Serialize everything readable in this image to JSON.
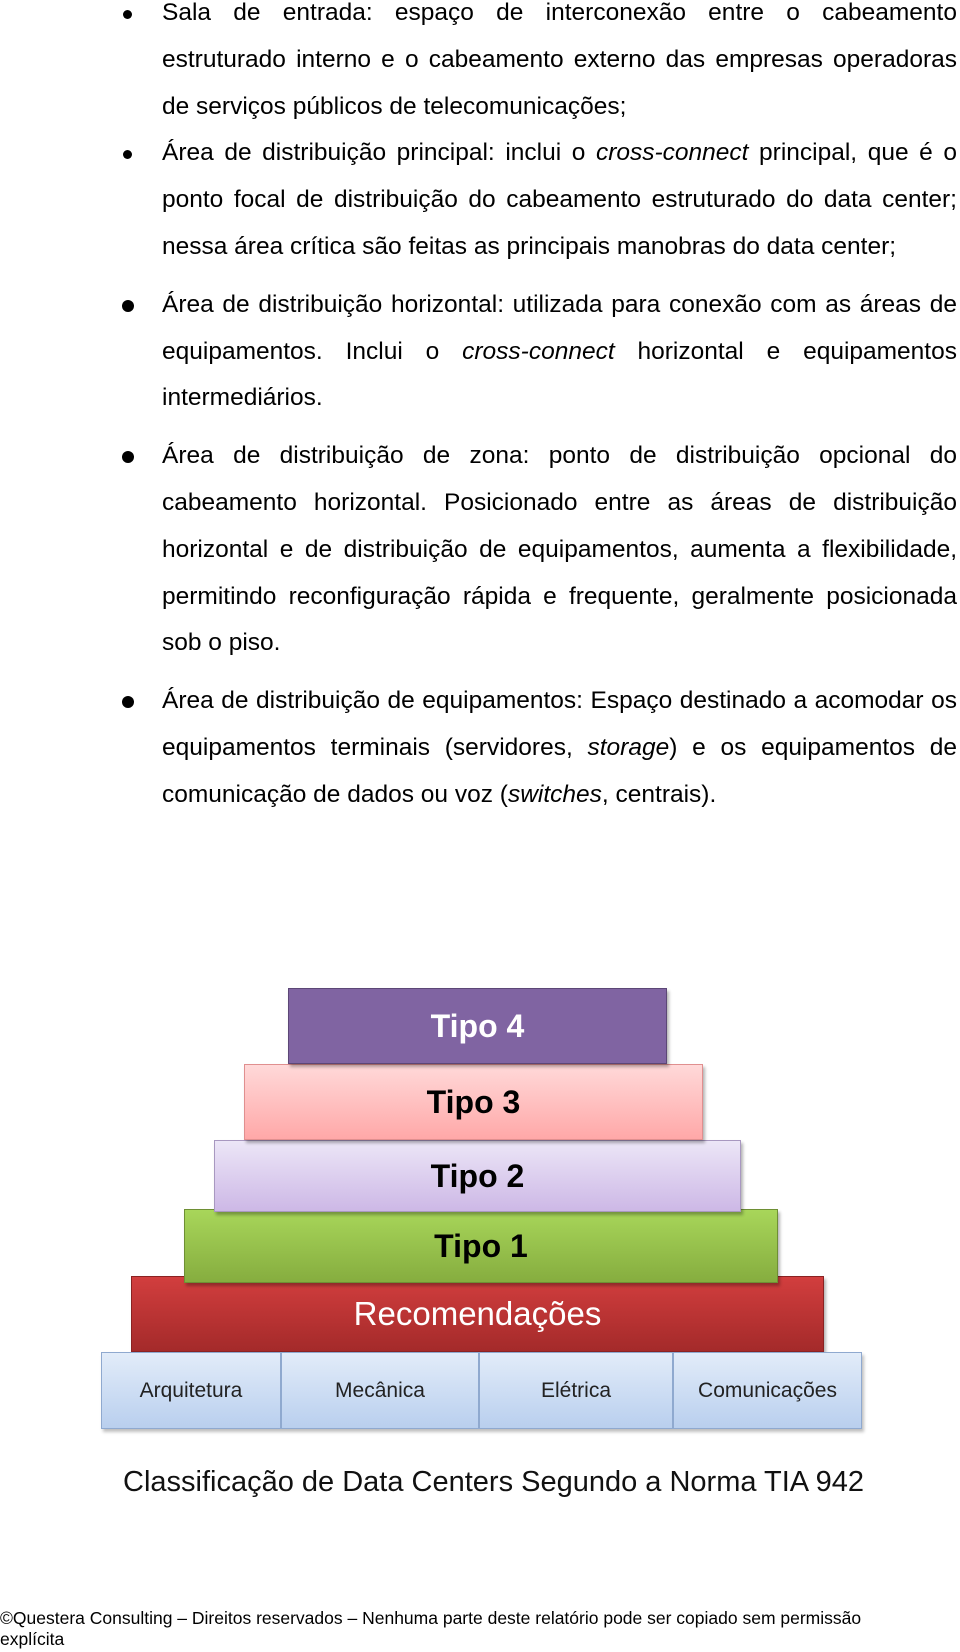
{
  "items": [
    {
      "parts": [
        "Sala de entrada: espaço de interconexão entre o cabeamento estruturado interno e o cabeamento externo das empresas operadoras de serviços públicos de telecomunicações;"
      ]
    },
    {
      "parts": [
        "Área de distribuição principal: inclui o ",
        "cross-connect",
        " principal, que é o ponto focal de distribuição do cabeamento estruturado do data center; nessa área crítica são feitas as principais manobras do data center;"
      ]
    },
    {
      "parts": [
        "Área de distribuição horizontal: utilizada para conexão com as áreas de equipamentos. Inclui o ",
        "cross-connect",
        " horizontal e equipamentos intermediários."
      ]
    },
    {
      "parts": [
        "Área de distribuição de zona: ponto de distribuição opcional do cabeamento horizontal. Posicionado entre as áreas de distribuição horizontal e de distribuição de equipamentos, aumenta a flexibilidade, permitindo reconfiguração rápida e frequente, geralmente posicionada sob o piso."
      ]
    },
    {
      "parts": [
        "Área de distribuição de equipamentos: Espaço destinado a acomodar os equipamentos terminais (servidores, ",
        "storage",
        ") e os equipamentos de comunicação de dados ou voz (",
        "switches",
        ", centrais)."
      ]
    }
  ],
  "diagram": {
    "tiers": [
      "Tipo 4",
      "Tipo 3",
      "Tipo 2",
      "Tipo 1",
      "Recomendações"
    ],
    "base": [
      "Arquitetura",
      "Mecânica",
      "Elétrica",
      "Comunicações"
    ],
    "colors": {
      "tipo4": "#8064a2",
      "tipo3": "#ffb3b3",
      "tipo2": "#d9c9ee",
      "tipo1": "#9bc74f",
      "recomendacoes": "#c0392b",
      "base": "#c8daf2"
    },
    "caption": "Classificação de Data Centers Segundo a Norma TIA 942"
  },
  "footer": "©Questera Consulting – Direitos reservados – Nenhuma parte deste relatório pode ser copiado sem permissão explícita"
}
